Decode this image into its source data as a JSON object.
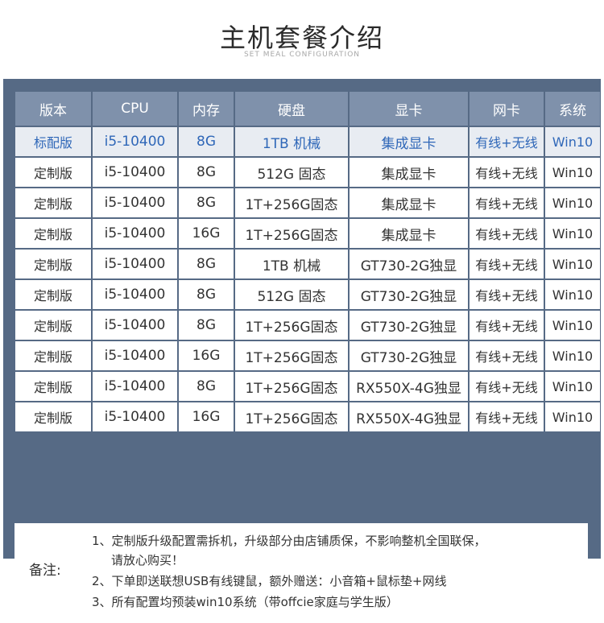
{
  "header": {
    "title": "主机套餐介绍",
    "subtitle": "SET MEAL CONFIGURATION"
  },
  "table": {
    "columns": [
      "版本",
      "CPU",
      "内存",
      "硬盘",
      "显卡",
      "网卡",
      "系统"
    ],
    "rows": [
      [
        "标配版",
        "i5-10400",
        "8G",
        "1TB 机械",
        "集成显卡",
        "有线+无线",
        "Win10"
      ],
      [
        "定制版",
        "i5-10400",
        "8G",
        "512G 固态",
        "集成显卡",
        "有线+无线",
        "Win10"
      ],
      [
        "定制版",
        "i5-10400",
        "8G",
        "1T+256G固态",
        "集成显卡",
        "有线+无线",
        "Win10"
      ],
      [
        "定制版",
        "i5-10400",
        "16G",
        "1T+256G固态",
        "集成显卡",
        "有线+无线",
        "Win10"
      ],
      [
        "定制版",
        "i5-10400",
        "8G",
        "1TB 机械",
        "GT730-2G独显",
        "有线+无线",
        "Win10"
      ],
      [
        "定制版",
        "i5-10400",
        "8G",
        "512G 固态",
        "GT730-2G独显",
        "有线+无线",
        "Win10"
      ],
      [
        "定制版",
        "i5-10400",
        "8G",
        "1T+256G固态",
        "GT730-2G独显",
        "有线+无线",
        "Win10"
      ],
      [
        "定制版",
        "i5-10400",
        "16G",
        "1T+256G固态",
        "GT730-2G独显",
        "有线+无线",
        "Win10"
      ],
      [
        "定制版",
        "i5-10400",
        "8G",
        "1T+256G固态",
        "RX550X-4G独显",
        "有线+无线",
        "Win10"
      ],
      [
        "定制版",
        "i5-10400",
        "16G",
        "1T+256G固态",
        "RX550X-4G独显",
        "有线+无线",
        "Win10"
      ]
    ]
  },
  "notes": {
    "label": "备注:",
    "items": [
      "1、定制版升级配置需拆机，升级部分由店铺质保，不影响整机全国联保，",
      "请放心购买！",
      "2、下单即送联想USB有线键鼠，额外赠送：小音箱+鼠标垫+网线",
      "3、所有配置均预装win10系统（带offcie家庭与学生版）"
    ]
  },
  "colors": {
    "frame": "#566a85",
    "header_cell": "#7f91ab",
    "highlight_row_bg": "#e8ecf2",
    "highlight_text": "#2f67b8"
  }
}
